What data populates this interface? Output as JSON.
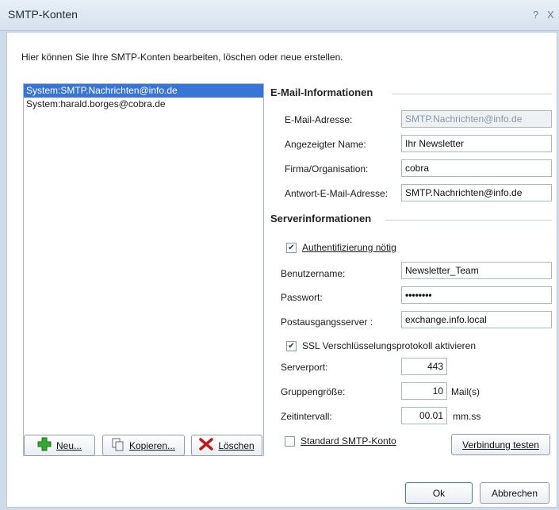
{
  "window": {
    "title": "SMTP-Konten",
    "help_glyph": "?",
    "close_glyph": "X"
  },
  "intro": "Hier können Sie Ihre SMTP-Konten bearbeiten, löschen oder neue erstellen.",
  "accounts": [
    {
      "label": "System:SMTP.Nachrichten@info.de",
      "selected": true
    },
    {
      "label": "System:harald.borges@cobra.de",
      "selected": false
    }
  ],
  "buttons": {
    "new": "Neu...",
    "copy": "Kopieren...",
    "delete": "Löschen",
    "test": "Verbindung testen",
    "ok": "Ok",
    "cancel": "Abbrechen"
  },
  "email_info": {
    "heading": "E-Mail-Informationen",
    "address_label": "E-Mail-Adresse:",
    "address_value": "SMTP.Nachrichten@info.de",
    "display_name_label": "Angezeigter Name:",
    "display_name_value": "Ihr Newsletter",
    "company_label": "Firma/Organisation:",
    "company_value": "cobra",
    "reply_label": "Antwort-E-Mail-Adresse:",
    "reply_value": "SMTP.Nachrichten@info.de"
  },
  "server_info": {
    "heading": "Serverinformationen",
    "auth_label": "Authentifizierung nötig",
    "auth_checked": true,
    "user_label": "Benutzername:",
    "user_value": "Newsletter_Team",
    "password_label": "Passwort:",
    "password_value": "••••••••",
    "server_label": "Postausgangsserver :",
    "server_value": "exchange.info.local",
    "ssl_label": "SSL Verschlüsselungsprotokoll aktivieren",
    "ssl_checked": true,
    "port_label": "Serverport:",
    "port_value": "443",
    "group_label": "Gruppengröße:",
    "group_value": "10",
    "group_unit": "Mail(s)",
    "interval_label": "Zeitintervall:",
    "interval_value": "00.01",
    "interval_unit": "mm.ss",
    "default_label": "Standard SMTP-Konto",
    "default_checked": false
  },
  "colors": {
    "selection": "#3875d7",
    "titlebar": "#dfe8f2"
  }
}
